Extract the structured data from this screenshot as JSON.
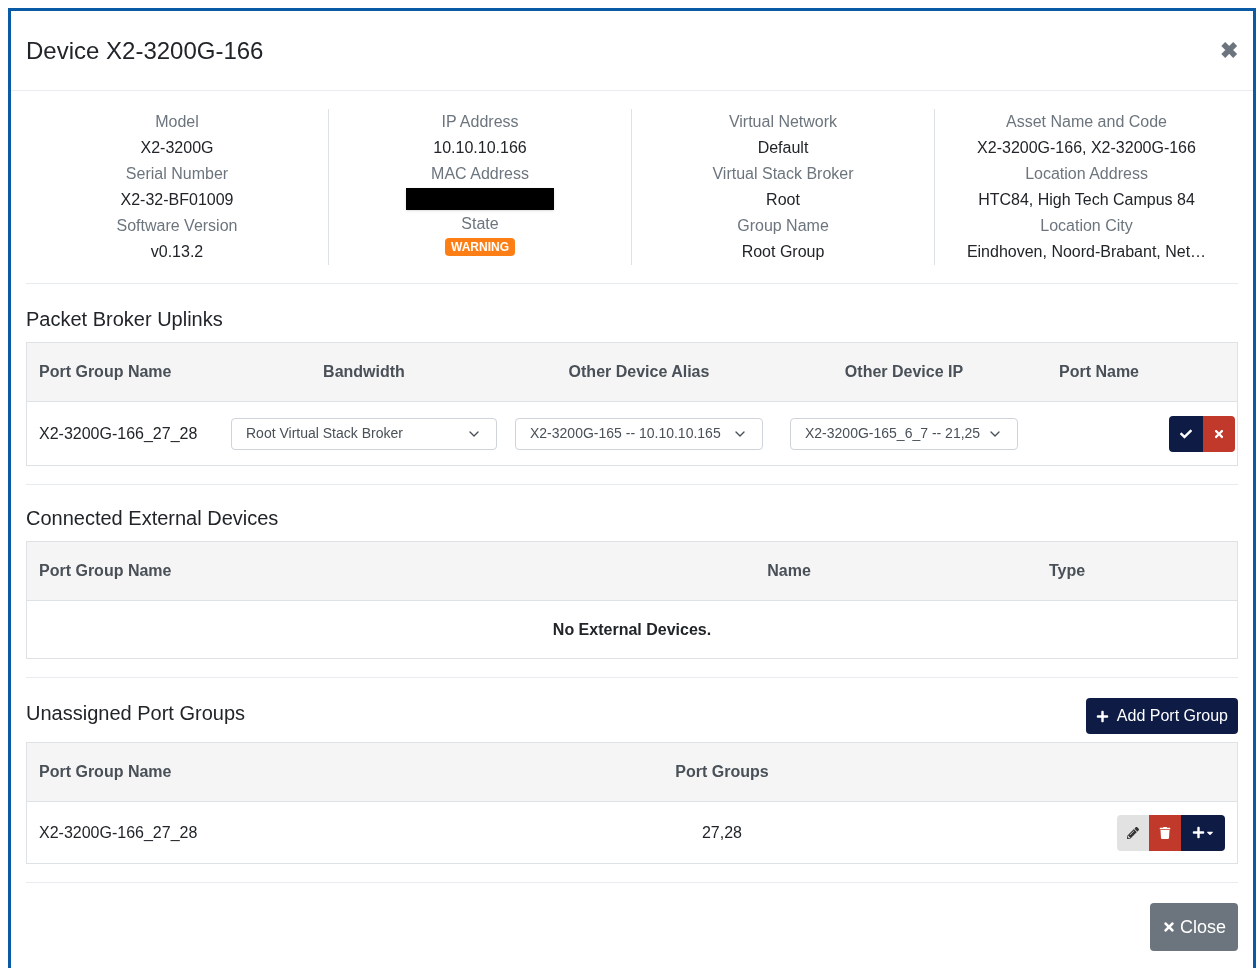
{
  "dialog": {
    "title": "Device X2-3200G-166",
    "close_icon": "✖"
  },
  "info_columns": [
    {
      "fields": [
        {
          "label": "Model",
          "kind": "text",
          "value": "X2-3200G"
        },
        {
          "label": "Serial Number",
          "kind": "text",
          "value": "X2-32-BF01009"
        },
        {
          "label": "Software Version",
          "kind": "text",
          "value": "v0.13.2"
        }
      ]
    },
    {
      "fields": [
        {
          "label": "IP Address",
          "kind": "text",
          "value": "10.10.10.166"
        },
        {
          "label": "MAC Address",
          "kind": "redacted"
        },
        {
          "label": "State",
          "kind": "badge",
          "value": "WARNING"
        }
      ]
    },
    {
      "fields": [
        {
          "label": "Virtual Network",
          "kind": "text",
          "value": "Default"
        },
        {
          "label": "Virtual Stack Broker",
          "kind": "text",
          "value": "Root"
        },
        {
          "label": "Group Name",
          "kind": "text",
          "value": "Root Group"
        }
      ]
    },
    {
      "fields": [
        {
          "label": "Asset Name and Code",
          "kind": "text",
          "value": "X2-3200G-166, X2-3200G-166"
        },
        {
          "label": "Location Address",
          "kind": "text",
          "value": "HTC84, High Tech Campus 84"
        },
        {
          "label": "Location City",
          "kind": "text",
          "value": "Eindhoven, Noord-Brabant, Net…"
        }
      ]
    }
  ],
  "uplinks": {
    "title": "Packet Broker Uplinks",
    "columns": [
      "Port Group Name",
      "Bandwidth",
      "Other Device Alias",
      "Other Device IP",
      "Port Name"
    ],
    "rows": [
      {
        "port_group_name": "X2-3200G-166_27_28",
        "bandwidth": "Root Virtual Stack Broker",
        "other_device_alias": "X2-3200G-165 -- 10.10.10.165",
        "other_device_ip": "X2-3200G-165_6_7 -- 21,25"
      }
    ]
  },
  "external": {
    "title": "Connected External Devices",
    "columns": [
      "Port Group Name",
      "Name",
      "Type"
    ],
    "empty_message": "No External Devices."
  },
  "unassigned": {
    "title": "Unassigned Port Groups",
    "add_button": "Add Port Group",
    "columns": [
      "Port Group Name",
      "Port Groups"
    ],
    "rows": [
      {
        "port_group_name": "X2-3200G-166_27_28",
        "port_groups": "27,28"
      }
    ]
  },
  "footer": {
    "close_button": "Close"
  }
}
